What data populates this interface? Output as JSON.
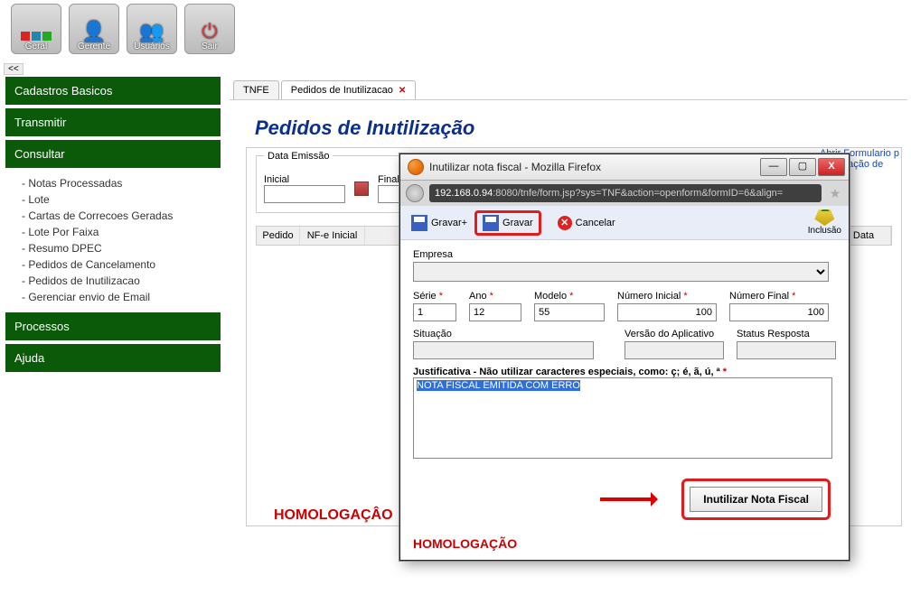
{
  "toolbar": {
    "geral": "Geral",
    "gerente": "Gerente",
    "usuarios": "Usuários",
    "sair": "Sair"
  },
  "collapse": "<<",
  "sidebar": {
    "cadastros": "Cadastros Basicos",
    "transmitir": "Transmitir",
    "consultar": "Consultar",
    "submenu": [
      "- Notas Processadas",
      "- Lote",
      "- Cartas de Correcoes Geradas",
      "- Lote Por Faixa",
      "- Resumo DPEC",
      "- Pedidos de Cancelamento",
      "- Pedidos de Inutilizacao",
      "- Gerenciar envio de Email"
    ],
    "processos": "Processos",
    "ajuda": "Ajuda"
  },
  "tabs": {
    "tnfe": "TNFE",
    "pedidos": "Pedidos de Inutilizacao"
  },
  "page_title": "Pedidos de Inutilização",
  "filters": {
    "data_emissao": "Data Emissão",
    "inicial": "Inicial",
    "final": "Final",
    "inicial_val": "",
    "final_val": ""
  },
  "right_link": "Abrir Formulario p\nInutilização de",
  "grid": {
    "pedido": "Pedido",
    "nfe_inicial": "NF-e Inicial",
    "data": "Data"
  },
  "homolog": "HOMOLOGAÇÂO",
  "popup": {
    "title": "Inutilizar nota fiscal - Mozilla Firefox",
    "url_host": "192.168.0.94",
    "url_rest": ":8080/tnfe/form.jsp?sys=TNF&action=openform&formID=6&align=",
    "gravar_plus": "Gravar+",
    "gravar": "Gravar",
    "cancelar": "Cancelar",
    "inclusao": "Inclusão",
    "fields": {
      "empresa": "Empresa",
      "empresa_val": "",
      "serie": "Série",
      "serie_val": "1",
      "ano": "Ano",
      "ano_val": "12",
      "modelo": "Modelo",
      "modelo_val": "55",
      "num_ini": "Número Inicial",
      "num_ini_val": "100",
      "num_fin": "Número Final",
      "num_fin_val": "100",
      "situacao": "Situação",
      "situacao_val": "",
      "versao": "Versão do Aplicativo",
      "versao_val": "",
      "status": "Status Resposta",
      "status_val": ""
    },
    "just_label": "Justificativa - Não utilizar caracteres especiais, como: ç; é, ã, ú, ª",
    "just_val": "NOTA FISCAL EMITIDA COM ERRO",
    "inutilizar": "Inutilizar Nota Fiscal",
    "footer": "HOMOLOGAÇÃO"
  }
}
